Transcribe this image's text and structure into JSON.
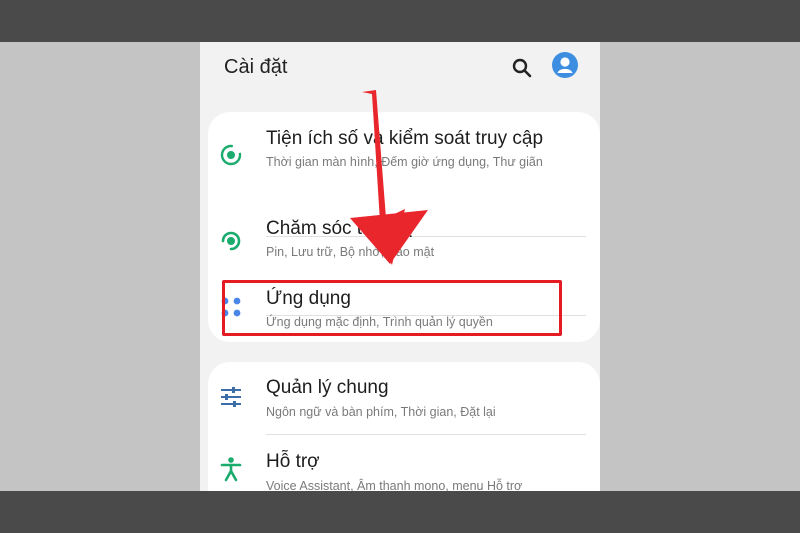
{
  "header": {
    "title": "Cài đặt",
    "search_icon": "search-icon",
    "avatar_icon": "account-icon"
  },
  "colors": {
    "accent_green": "#1aab6d",
    "accent_blue": "#4a86e8",
    "highlight_red": "#e41b23",
    "arrow_red": "#e8262c"
  },
  "card1": {
    "items": [
      {
        "icon": "digital-wellbeing-icon",
        "title": "Tiện ích số và kiểm soát truy cập",
        "subtitle": "Thời gian màn hình, Đếm giờ ứng dụng, Thư giãn"
      },
      {
        "icon": "device-care-icon",
        "title": "Chăm sóc thiết bị",
        "subtitle": "Pin, Lưu trữ, Bộ nhớ, Bảo mật"
      },
      {
        "icon": "apps-icon",
        "title": "Ứng dụng",
        "subtitle": "Ứng dụng mặc định, Trình quản lý quyền"
      }
    ]
  },
  "card2": {
    "items": [
      {
        "icon": "general-management-icon",
        "title": "Quản lý chung",
        "subtitle": "Ngôn ngữ và bàn phím, Thời gian, Đặt lại"
      },
      {
        "icon": "accessibility-icon",
        "title": "Hỗ trợ",
        "subtitle": "Voice Assistant, Âm thanh mono, menu Hỗ trợ"
      }
    ]
  }
}
